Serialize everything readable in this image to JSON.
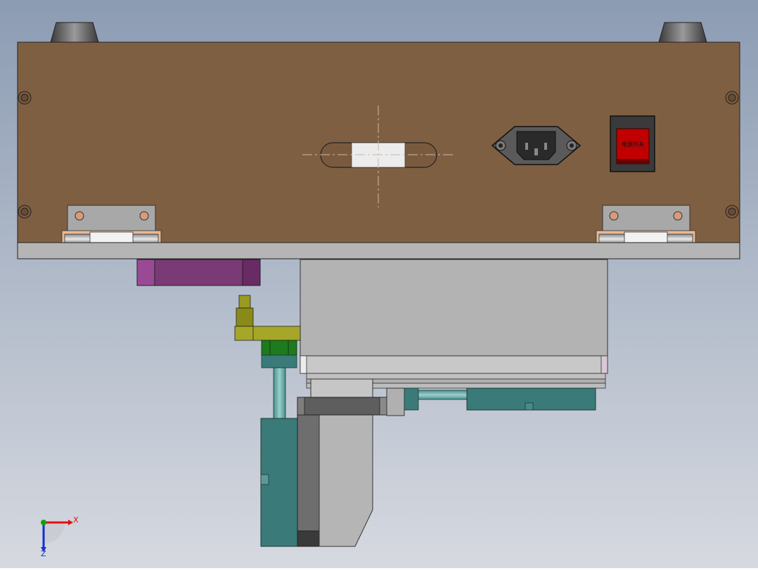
{
  "view": {
    "background_top": "#8c9cb3",
    "background_bottom": "#d6d9e0"
  },
  "colors": {
    "wood_panel": "#7f5f42",
    "steel": "#b5b5b5",
    "dark_steel": "#5a5a5a",
    "magenta_block": "#7a3a75",
    "teal_parts": "#3a7a78",
    "olive_fitting": "#9a9a20",
    "green_fitting": "#1e7a1e",
    "switch_red": "#c00000",
    "axis_x": "#e01010",
    "axis_y": "#10a010",
    "axis_z": "#1030d0"
  },
  "power_switch": {
    "label": "电源开关",
    "icon": "rocker-switch-icon"
  },
  "power_socket": {
    "icon": "iec-power-socket-icon"
  },
  "slot": {
    "icon": "slotted-hole-icon"
  },
  "hinges": {
    "icon": "hinge-icon"
  },
  "triad": {
    "x_label": "X",
    "z_label": "Z",
    "icon": "coordinate-triad-icon"
  }
}
